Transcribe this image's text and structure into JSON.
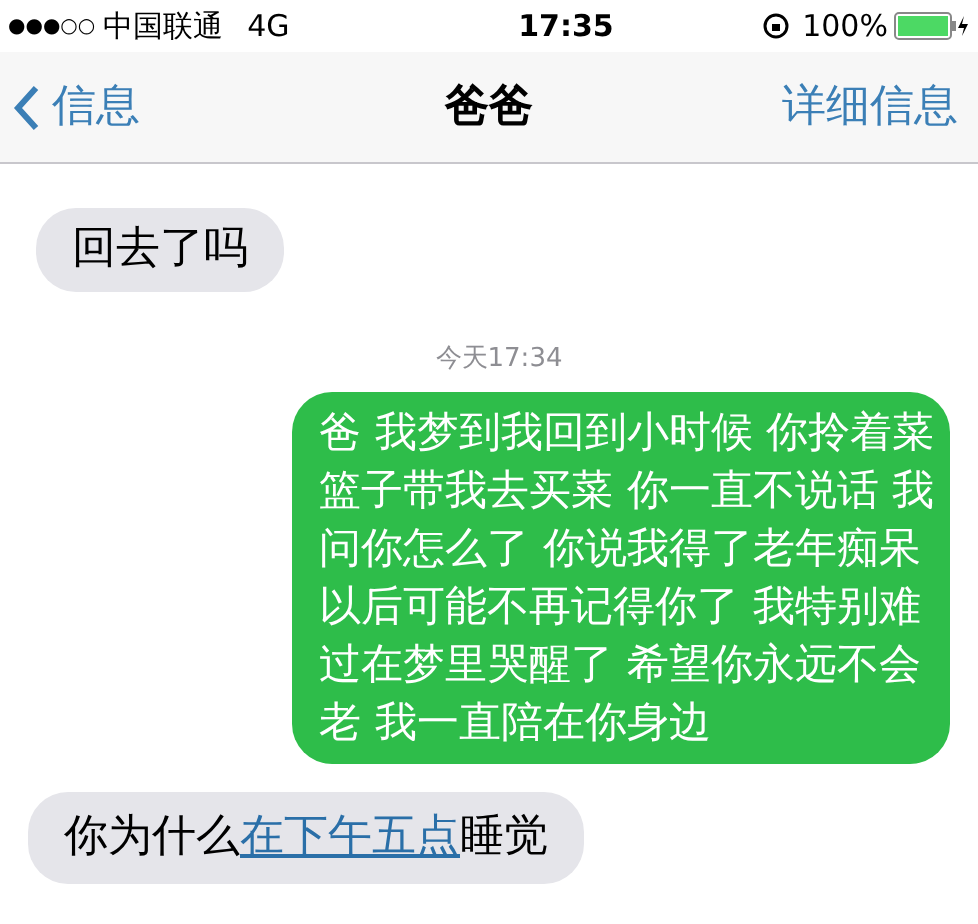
{
  "status_bar": {
    "signal_dots": "●●●○○",
    "carrier": "中国联通",
    "network": "4G",
    "time": "17:35",
    "battery": "100%"
  },
  "nav_bar": {
    "back": "信息",
    "title": "爸爸",
    "details": "详细信息"
  },
  "messages": [
    {
      "kind": "incoming",
      "text": "回去了吗"
    },
    {
      "kind": "timestamp",
      "text": "今天17:34"
    },
    {
      "kind": "outgoing",
      "lines": [
        "爸 我梦到我回到小时候 你拎着菜",
        "篮子带我去买菜 你一直不说话 我",
        "问你怎么了 你说我得了老年痴呆",
        "以后可能不再记得你了 我特别难",
        "过在梦里哭醒了 希望你永远不会",
        "老 我一直陪在你身边"
      ]
    },
    {
      "kind": "incoming_link",
      "before": "你为什么",
      "link": "在下午五点",
      "after": "睡觉"
    }
  ]
}
